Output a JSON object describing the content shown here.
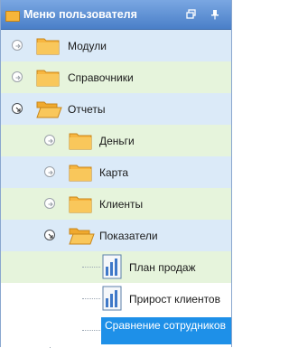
{
  "panel": {
    "title": "Меню пользователя",
    "icons": {
      "header": "folder-icon",
      "restore": "restore-window-icon",
      "pin": "pin-icon"
    }
  },
  "tree": {
    "items": [
      {
        "label": "Модули",
        "state": "collapsed",
        "icon": "folder-icon"
      },
      {
        "label": "Справочники",
        "state": "collapsed",
        "icon": "folder-icon"
      },
      {
        "label": "Отчеты",
        "state": "expanded",
        "icon": "folder-open-icon"
      },
      {
        "label": "Деньги",
        "state": "collapsed",
        "icon": "folder-icon"
      },
      {
        "label": "Карта",
        "state": "collapsed",
        "icon": "folder-icon"
      },
      {
        "label": "Клиенты",
        "state": "collapsed",
        "icon": "folder-icon"
      },
      {
        "label": "Показатели",
        "state": "expanded",
        "icon": "folder-open-icon"
      },
      {
        "label": "План продаж",
        "icon": "report-icon"
      },
      {
        "label": "Прирост клиентов",
        "icon": "report-icon"
      },
      {
        "label": "Сравнение сотрудников",
        "icon": "report-icon",
        "selected": true
      }
    ]
  },
  "colors": {
    "header": "#4a7fc8",
    "row_blue": "#dbeaf8",
    "row_green": "#e6f4dc",
    "selection": "#1e90e8"
  }
}
